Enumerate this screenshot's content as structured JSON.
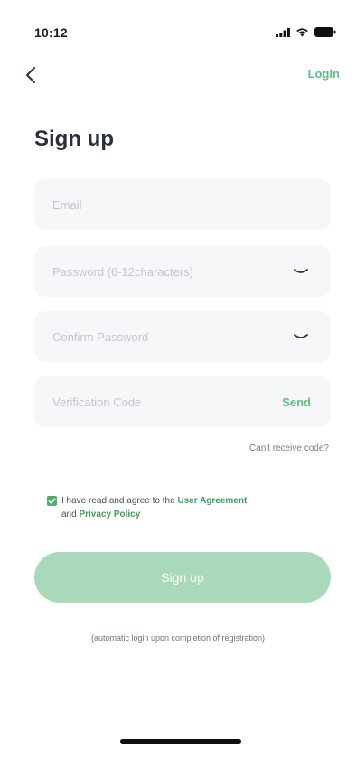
{
  "status_bar": {
    "time": "10:12",
    "icons": [
      "signal-icon",
      "wifi-icon",
      "battery-icon"
    ]
  },
  "nav": {
    "back_icon": "chevron-left-icon",
    "login_label": "Login"
  },
  "title": "Sign up",
  "form": {
    "email": {
      "placeholder": "Email",
      "value": ""
    },
    "password": {
      "placeholder": "Password (6-12characters)",
      "value": "",
      "toggle_icon": "eye-closed-icon"
    },
    "confirm_password": {
      "placeholder": "Confirm Password",
      "value": "",
      "toggle_icon": "eye-closed-icon"
    },
    "verification_code": {
      "placeholder": "Verification Code",
      "value": "",
      "send_label": "Send"
    },
    "cant_receive": "Can't receive code?"
  },
  "agreement": {
    "checked": true,
    "prefix": "I have read and agree to the ",
    "user_agreement": "User Agreement",
    "and": "and ",
    "privacy_policy": "Privacy Policy"
  },
  "signup_button": "Sign up",
  "note": "(automatic login upon completion of registration)",
  "colors": {
    "accent": "#5fbf82",
    "button_disabled": "#a9d9b8",
    "field_bg": "#f6f7f9"
  }
}
